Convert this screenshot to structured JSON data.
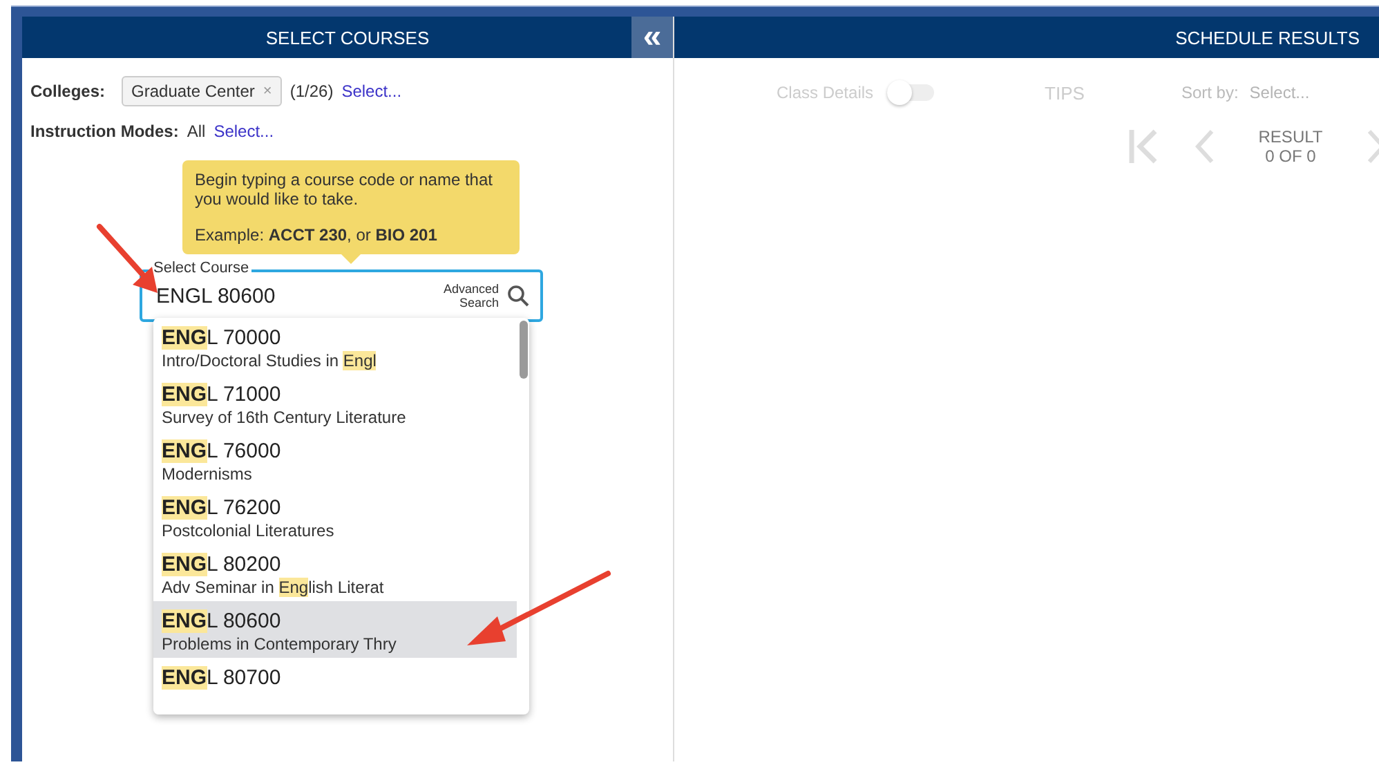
{
  "left_panel": {
    "title": "SELECT COURSES",
    "collapse_icon": "«",
    "colleges": {
      "label": "Colleges:",
      "chips": [
        {
          "text": "Graduate Center",
          "remove": "×"
        }
      ],
      "count": "(1/26)",
      "link": "Select..."
    },
    "instruction_modes": {
      "label": "Instruction Modes:",
      "value": "All",
      "link": "Select..."
    },
    "tooltip": {
      "lines": [
        "Begin typing a course code or name that you would like to take.",
        "Example: **ACCT 230**, or **BIO 201**"
      ]
    },
    "course_field": {
      "label": "Select Course",
      "value": "ENGL 80600",
      "advanced": "Advanced Search"
    },
    "suggestions": [
      {
        "code": [
          {
            "text": "ENG",
            "highlighted": true
          },
          {
            "text": "L 70000",
            "highlighted": false
          }
        ],
        "name": [
          {
            "text": "Intro/Doctoral Studies in ",
            "highlighted": false
          },
          {
            "text": "Engl",
            "highlighted": true
          }
        ],
        "selected": false
      },
      {
        "code": [
          {
            "text": "ENG",
            "highlighted": true
          },
          {
            "text": "L 71000",
            "highlighted": false
          }
        ],
        "name": [
          {
            "text": "Survey of 16th Century Literature",
            "highlighted": false
          }
        ],
        "selected": false
      },
      {
        "code": [
          {
            "text": "ENG",
            "highlighted": true
          },
          {
            "text": "L 76000",
            "highlighted": false
          }
        ],
        "name": [
          {
            "text": "Modernisms",
            "highlighted": false
          }
        ],
        "selected": false
      },
      {
        "code": [
          {
            "text": "ENG",
            "highlighted": true
          },
          {
            "text": "L 76200",
            "highlighted": false
          }
        ],
        "name": [
          {
            "text": "Postcolonial Literatures",
            "highlighted": false
          }
        ],
        "selected": false
      },
      {
        "code": [
          {
            "text": "ENG",
            "highlighted": true
          },
          {
            "text": "L 80200",
            "highlighted": false
          }
        ],
        "name": [
          {
            "text": "Adv Seminar in ",
            "highlighted": false
          },
          {
            "text": "Eng",
            "highlighted": true
          },
          {
            "text": "lish Literat",
            "highlighted": false
          }
        ],
        "selected": false
      },
      {
        "code": [
          {
            "text": "ENG",
            "highlighted": true
          },
          {
            "text": "L 80600",
            "highlighted": false
          }
        ],
        "name": [
          {
            "text": "Problems in Contemporary Thry",
            "highlighted": false
          }
        ],
        "selected": true
      },
      {
        "code": [
          {
            "text": "ENG",
            "highlighted": true
          },
          {
            "text": "L 80700",
            "highlighted": false
          }
        ],
        "selected": false
      }
    ]
  },
  "right_panel": {
    "title": "SCHEDULE RESULTS",
    "class_details": {
      "label": "Class Details",
      "on": false
    },
    "tips": "TIPS",
    "sort": {
      "label": "Sort by:",
      "placeholder": "Select..."
    },
    "result": {
      "label": "RESULT",
      "count": "0 OF 0"
    }
  }
}
